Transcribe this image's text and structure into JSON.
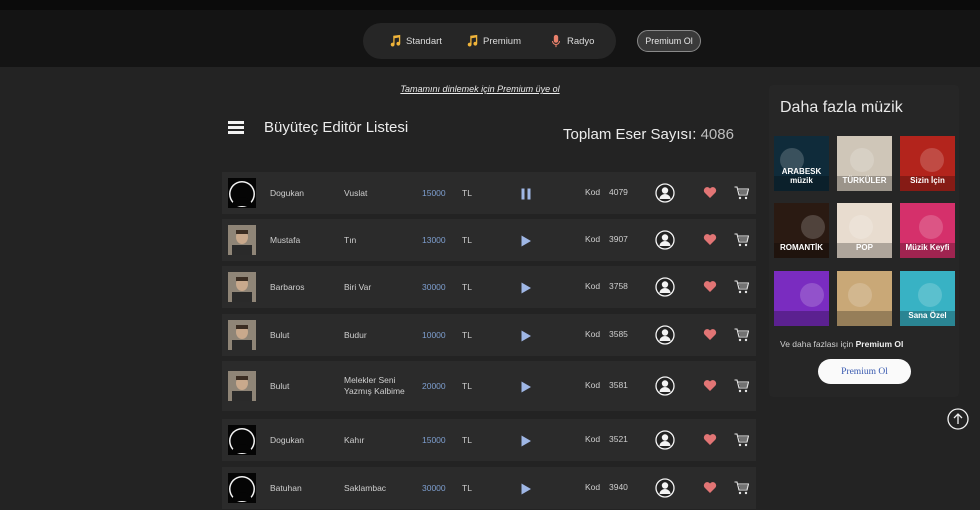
{
  "nav": {
    "items": [
      {
        "label": "Standart",
        "icon": "music-note-icon"
      },
      {
        "label": "Premium",
        "icon": "music-note-icon"
      },
      {
        "label": "Radyo",
        "icon": "microphone-icon"
      }
    ],
    "premium_button": "Premium Ol"
  },
  "promo_link": "Tamamını dinlemek için Premium üye ol",
  "list": {
    "title": "Büyüteç Editör Listesi",
    "total_label": "Toplam Eser Sayısı:",
    "total_value": "4086"
  },
  "rows": [
    {
      "artist": "Dogukan",
      "song": "Vuslat",
      "song2": "",
      "price": "15000",
      "currency": "TL",
      "code_label": "Kod",
      "code": "4079",
      "state": "pause",
      "avatar": "silhouette"
    },
    {
      "artist": "Mustafa",
      "song": "Tın",
      "song2": "",
      "price": "13000",
      "currency": "TL",
      "code_label": "Kod",
      "code": "3907",
      "state": "play",
      "avatar": "photo"
    },
    {
      "artist": "Barbaros",
      "song": "Biri Var",
      "song2": "",
      "price": "30000",
      "currency": "TL",
      "code_label": "Kod",
      "code": "3758",
      "state": "play",
      "avatar": "photo"
    },
    {
      "artist": "Bulut",
      "song": "Budur",
      "song2": "",
      "price": "10000",
      "currency": "TL",
      "code_label": "Kod",
      "code": "3585",
      "state": "play",
      "avatar": "photo"
    },
    {
      "artist": "Bulut",
      "song": "Melekler Seni",
      "song2": "Yazmış Kalbime",
      "price": "20000",
      "currency": "TL",
      "code_label": "Kod",
      "code": "3581",
      "state": "play",
      "avatar": "photo"
    },
    {
      "artist": "Dogukan",
      "song": "Kahır",
      "song2": "",
      "price": "15000",
      "currency": "TL",
      "code_label": "Kod",
      "code": "3521",
      "state": "play",
      "avatar": "silhouette"
    },
    {
      "artist": "Batuhan",
      "song": "Saklambac",
      "song2": "",
      "price": "30000",
      "currency": "TL",
      "code_label": "Kod",
      "code": "3940",
      "state": "play",
      "avatar": "silhouette"
    }
  ],
  "sidebar": {
    "title": "Daha fazla müzik",
    "thumbnails": [
      {
        "text": "ARABESK müzik",
        "bg": "#0f2b3a"
      },
      {
        "text": "TÜRKÜLER",
        "bg": "#cfc6b8"
      },
      {
        "text": "Sizin İçin",
        "bg": "#b3241c"
      },
      {
        "text": "ROMANTİK",
        "bg": "#2a1a12"
      },
      {
        "text": "POP",
        "bg": "#e8dccf"
      },
      {
        "text": "Müzik Keyfi",
        "bg": "#d5306b"
      },
      {
        "text": "",
        "bg": "#7a2cc0"
      },
      {
        "text": "",
        "bg": "#c9a877"
      },
      {
        "text": "Sana Özel",
        "bg": "#38b2c4"
      }
    ],
    "note_prefix": "Ve daha fazlası için",
    "note_bold": "Premium Ol",
    "button": "Premium Ol"
  },
  "colors": {
    "accent_price": "#7e9fd0",
    "heart": "#e27575",
    "play": "#9fb7e6"
  }
}
